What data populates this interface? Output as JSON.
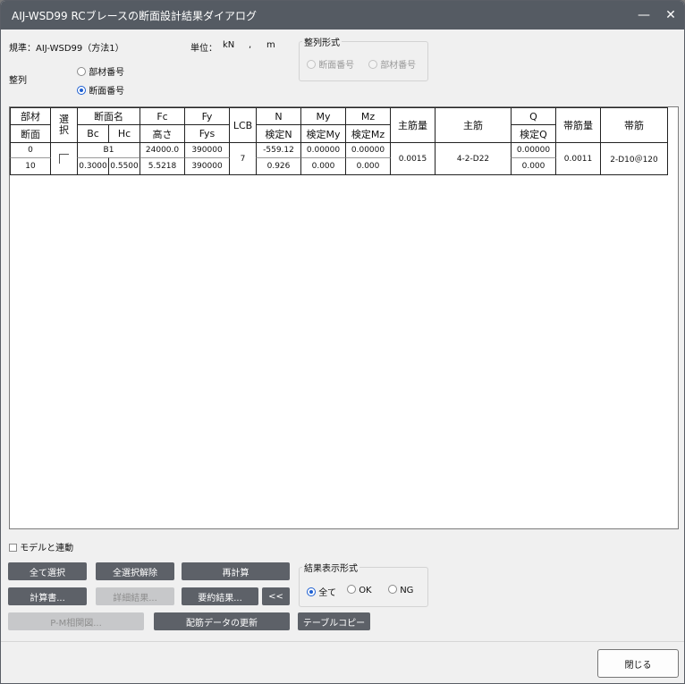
{
  "window": {
    "title": "AIJ-WSD99 RCブレースの断面設計結果ダイアログ",
    "minimize_glyph": "—",
    "close_glyph": "✕"
  },
  "info": {
    "standard": "規準：AIJ-WSD99（方法1）",
    "unit_label": "単位：",
    "unit_force": "kN",
    "unit_sep": ",",
    "unit_length": "m"
  },
  "sort": {
    "label": "整列",
    "options": [
      {
        "label": "部材番号",
        "selected": false
      },
      {
        "label": "断面番号",
        "selected": true
      }
    ],
    "format_title": "整列形式",
    "format_options": [
      {
        "label": "断面番号",
        "enabled": false
      },
      {
        "label": "部材番号",
        "enabled": false
      }
    ]
  },
  "table": {
    "headers": {
      "member": "部材",
      "section": "断面",
      "select": "選\n択",
      "section_name": "断面名",
      "bc": "Bc",
      "hc": "Hc",
      "fc": "Fc",
      "height": "高さ",
      "fy": "Fy",
      "fys": "Fys",
      "lcb": "LCB",
      "n": "N",
      "check_n": "検定N",
      "my": "My",
      "check_my": "検定My",
      "mz": "Mz",
      "check_mz": "検定Mz",
      "main_rebar_ratio": "主筋量",
      "main_rebar": "主筋",
      "q": "Q",
      "check_q": "検定Q",
      "hoop_ratio": "帯筋量",
      "hoop": "帯筋"
    },
    "row": {
      "member": "0",
      "section": "10",
      "section_name": "B1",
      "bc": "0.3000",
      "hc": "0.5500",
      "fc": "24000.0",
      "height": "5.5218",
      "fy": "390000",
      "fys": "390000",
      "lcb": "7",
      "n": "-559.12",
      "check_n": "0.926",
      "my": "0.00000",
      "check_my": "0.000",
      "mz": "0.00000",
      "check_mz": "0.000",
      "main_rebar_ratio": "0.0015",
      "main_rebar": "4-2-D22",
      "q": "0.00000",
      "check_q": "0.000",
      "hoop_ratio": "0.0011",
      "hoop": "2-D10＠120"
    }
  },
  "link_model": "モデルと連動",
  "buttons": {
    "select_all": "全て選択",
    "deselect_all": "全選択解除",
    "recalc": "再計算",
    "report": "計算書...",
    "details": "詳細結果...",
    "summary": "要約結果...",
    "collapse": "<<",
    "pm": "P-M相関図...",
    "update_rebar": "配筋データの更新",
    "copy_table": "テーブルコピー",
    "close": "閉じる"
  },
  "result_filter": {
    "title": "結果表示形式",
    "options": [
      {
        "label": "全て",
        "selected": true
      },
      {
        "label": "OK",
        "selected": false
      },
      {
        "label": "NG",
        "selected": false
      }
    ]
  }
}
